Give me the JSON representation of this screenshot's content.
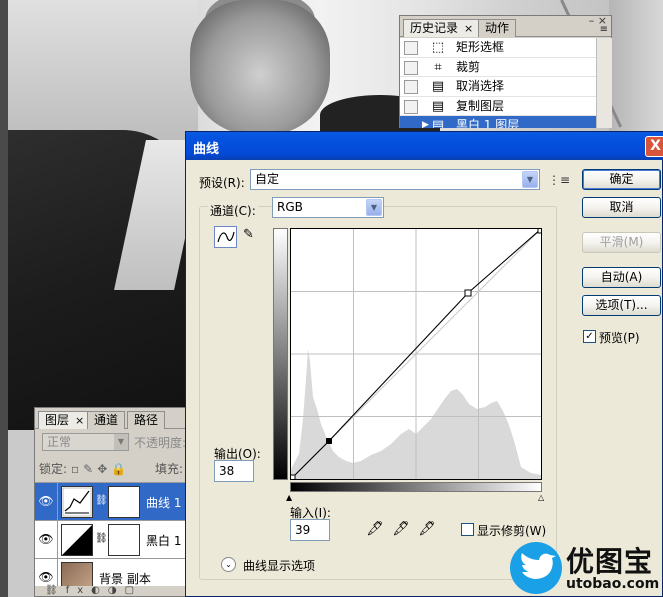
{
  "history_panel": {
    "tabs": [
      "历史记录",
      "动作"
    ],
    "tab_close": "×",
    "window_controls": "– ×",
    "menu_icon": "≡",
    "items": [
      {
        "label": "矩形选框",
        "icon": "marquee-icon"
      },
      {
        "label": "裁剪",
        "icon": "crop-icon"
      },
      {
        "label": "取消选择",
        "icon": "history-state-icon"
      },
      {
        "label": "复制图层",
        "icon": "history-state-icon"
      },
      {
        "label": "黑白 1 图层",
        "icon": "history-state-icon",
        "selected": true
      }
    ]
  },
  "layers_panel": {
    "tabs": [
      "图层",
      "通道",
      "路径"
    ],
    "tab_close": "×",
    "blend_mode": "正常",
    "opacity_label": "不透明度:",
    "lock_label": "锁定:",
    "fill_label": "填充:",
    "layers": [
      {
        "name": "曲线 1",
        "selected": true
      },
      {
        "name": "黑白 1",
        "selected": false
      },
      {
        "name": "背景 副本",
        "selected": false
      }
    ]
  },
  "curves_dialog": {
    "title": "曲线",
    "close": "X",
    "preset_label": "预设(R):",
    "preset_value": "自定",
    "channel_label": "通道(C):",
    "channel_value": "RGB",
    "output_label": "输出(O):",
    "output_value": "38",
    "input_label": "输入(I):",
    "input_value": "39",
    "show_clipping_label": "显示修剪(W)",
    "show_clipping_checked": false,
    "curve_display_options": "曲线显示选项",
    "buttons": {
      "ok": "确定",
      "cancel": "取消",
      "smooth": "平滑(M)",
      "auto": "自动(A)",
      "options": "选项(T)..."
    },
    "preview_label": "预览(P)",
    "preview_checked": true
  },
  "watermark": {
    "name": "优图宝",
    "url": "utobao.com"
  }
}
